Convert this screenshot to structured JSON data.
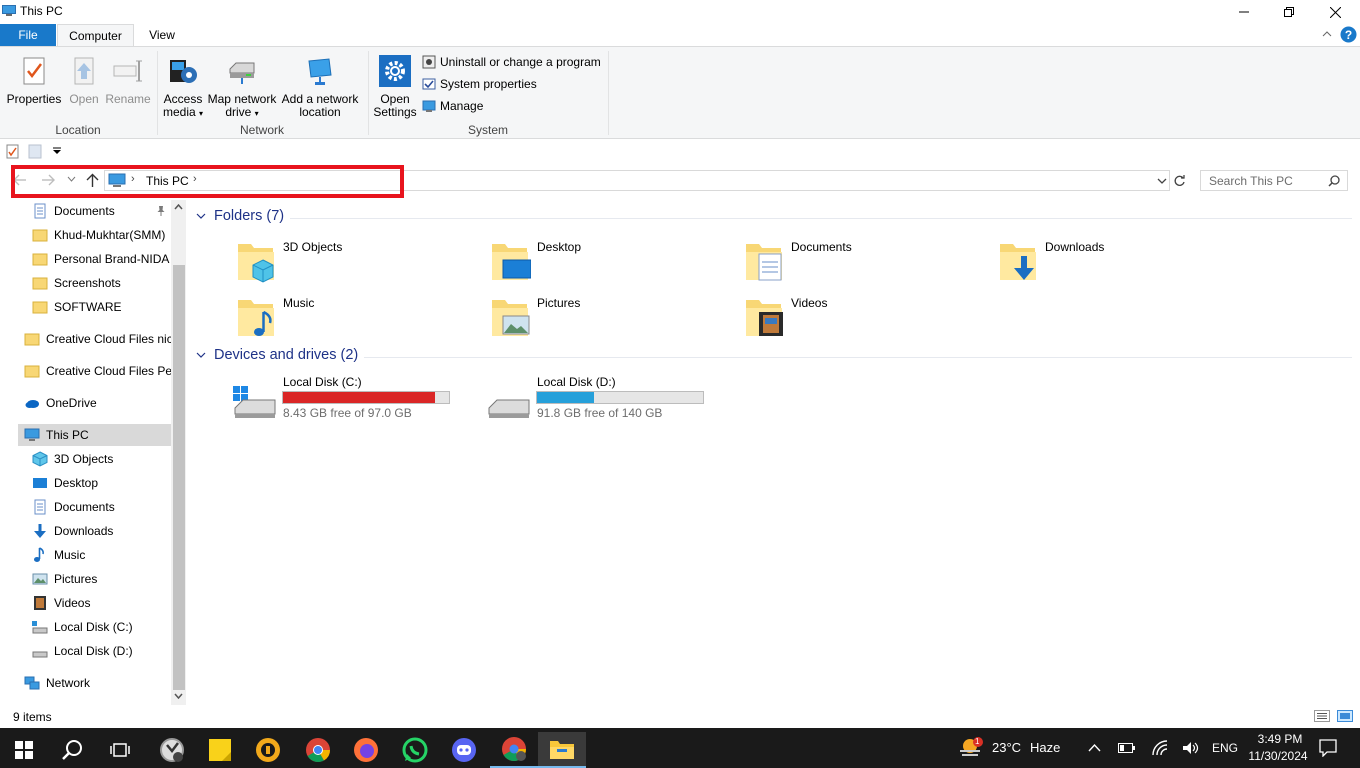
{
  "window": {
    "title": "This PC",
    "minimize_icon": "minimize-icon",
    "maximize_icon": "restore-icon",
    "close_icon": "close-icon"
  },
  "ribbon_tabs": {
    "file": "File",
    "computer": "Computer",
    "view": "View"
  },
  "ribbon": {
    "location": {
      "label": "Location",
      "properties": "Properties",
      "open": "Open",
      "rename": "Rename"
    },
    "network": {
      "label": "Network",
      "access_media_1": "Access",
      "access_media_2": "media",
      "map_drive_1": "Map network",
      "map_drive_2": "drive",
      "add_location_1": "Add a network",
      "add_location_2": "location"
    },
    "system": {
      "label": "System",
      "open_settings_1": "Open",
      "open_settings_2": "Settings",
      "uninstall": "Uninstall or change a program",
      "system_properties": "System properties",
      "manage": "Manage"
    }
  },
  "address": {
    "path": "This PC",
    "search_placeholder": "Search This PC"
  },
  "nav": {
    "quick_access": [
      {
        "label": "Documents",
        "icon": "documents-icon"
      },
      {
        "label": "Khud-Mukhtar(SMM)",
        "icon": "folder-icon"
      },
      {
        "label": "Personal Brand-NIDA I",
        "icon": "folder-icon"
      },
      {
        "label": "Screenshots",
        "icon": "folder-icon"
      },
      {
        "label": "SOFTWARE",
        "icon": "folder-icon"
      }
    ],
    "cc1": "Creative Cloud Files  nic",
    "cc2": "Creative Cloud Files Per",
    "onedrive": "OneDrive",
    "this_pc": "This PC",
    "this_pc_children": [
      {
        "label": "3D Objects",
        "icon": "3d-objects-icon"
      },
      {
        "label": "Desktop",
        "icon": "desktop-icon"
      },
      {
        "label": "Documents",
        "icon": "documents-icon"
      },
      {
        "label": "Downloads",
        "icon": "downloads-icon"
      },
      {
        "label": "Music",
        "icon": "music-icon"
      },
      {
        "label": "Pictures",
        "icon": "pictures-icon"
      },
      {
        "label": "Videos",
        "icon": "videos-icon"
      },
      {
        "label": "Local Disk (C:)",
        "icon": "drive-icon"
      },
      {
        "label": "Local Disk (D:)",
        "icon": "drive-icon"
      }
    ],
    "network": "Network"
  },
  "content": {
    "folders_header": "Folders (7)",
    "folders": [
      {
        "label": "3D Objects",
        "icon": "3d-objects-icon"
      },
      {
        "label": "Desktop",
        "icon": "desktop-icon"
      },
      {
        "label": "Documents",
        "icon": "documents-icon"
      },
      {
        "label": "Downloads",
        "icon": "downloads-icon"
      },
      {
        "label": "Music",
        "icon": "music-icon"
      },
      {
        "label": "Pictures",
        "icon": "pictures-icon"
      },
      {
        "label": "Videos",
        "icon": "videos-icon"
      }
    ],
    "drives_header": "Devices and drives (2)",
    "drives": [
      {
        "label": "Local Disk (C:)",
        "free": "8.43 GB free of 97.0 GB",
        "used_fraction": 0.913,
        "bar_color": "#da2626"
      },
      {
        "label": "Local Disk (D:)",
        "free": "91.8 GB free of 140 GB",
        "used_fraction": 0.344,
        "bar_color": "#26a0da"
      }
    ]
  },
  "status": {
    "items": "9 items"
  },
  "taskbar": {
    "weather_temp": "23°C",
    "weather_text": "Haze",
    "weather_badge": "1",
    "language": "ENG",
    "time": "3:49 PM",
    "date": "11/30/2024"
  }
}
